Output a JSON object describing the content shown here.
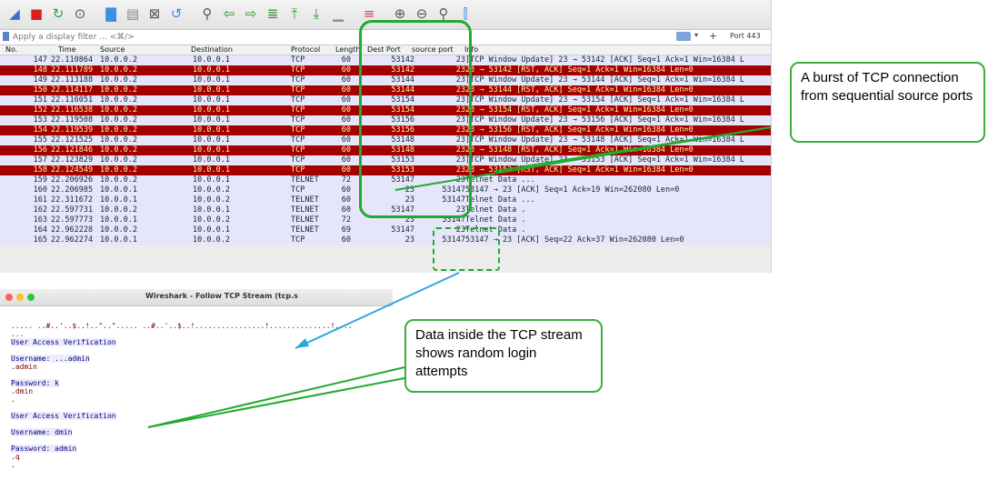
{
  "filter": {
    "placeholder": "Apply a display filter ... <⌘/>",
    "button_label": "Port 443"
  },
  "columns": [
    "No.",
    "Time",
    "Source",
    "Destination",
    "Protocol",
    "Length",
    "Dest Port",
    "source port",
    "Info"
  ],
  "packets": [
    {
      "no": "147",
      "time": "22.110864",
      "src": "10.0.0.2",
      "dst": "10.0.0.1",
      "proto": "TCP",
      "len": "60",
      "dport": "53142",
      "sport": "23",
      "info": "[TCP Window Update] 23 → 53142 [ACK] Seq=1 Ack=1 Win=16384 L",
      "kind": "win"
    },
    {
      "no": "148",
      "time": "22.111789",
      "src": "10.0.0.2",
      "dst": "10.0.0.1",
      "proto": "TCP",
      "len": "60",
      "dport": "53142",
      "sport": "23",
      "info": "23 → 53142 [RST, ACK] Seq=1 Ack=1 Win=16384 Len=0",
      "kind": "rst"
    },
    {
      "no": "149",
      "time": "22.113188",
      "src": "10.0.0.2",
      "dst": "10.0.0.1",
      "proto": "TCP",
      "len": "60",
      "dport": "53144",
      "sport": "23",
      "info": "[TCP Window Update] 23 → 53144 [ACK] Seq=1 Ack=1 Win=16384 L",
      "kind": "win"
    },
    {
      "no": "150",
      "time": "22.114117",
      "src": "10.0.0.2",
      "dst": "10.0.0.1",
      "proto": "TCP",
      "len": "60",
      "dport": "53144",
      "sport": "23",
      "info": "23 → 53144 [RST, ACK] Seq=1 Ack=1 Win=16384 Len=0",
      "kind": "rst"
    },
    {
      "no": "151",
      "time": "22.116051",
      "src": "10.0.0.2",
      "dst": "10.0.0.1",
      "proto": "TCP",
      "len": "60",
      "dport": "53154",
      "sport": "23",
      "info": "[TCP Window Update] 23 → 53154 [ACK] Seq=1 Ack=1 Win=16384 L",
      "kind": "win"
    },
    {
      "no": "152",
      "time": "22.116538",
      "src": "10.0.0.2",
      "dst": "10.0.0.1",
      "proto": "TCP",
      "len": "60",
      "dport": "53154",
      "sport": "23",
      "info": "23 → 53154 [RST, ACK] Seq=1 Ack=1 Win=16384 Len=0",
      "kind": "rst"
    },
    {
      "no": "153",
      "time": "22.119508",
      "src": "10.0.0.2",
      "dst": "10.0.0.1",
      "proto": "TCP",
      "len": "60",
      "dport": "53156",
      "sport": "23",
      "info": "[TCP Window Update] 23 → 53156 [ACK] Seq=1 Ack=1 Win=16384 L",
      "kind": "win"
    },
    {
      "no": "154",
      "time": "22.119539",
      "src": "10.0.0.2",
      "dst": "10.0.0.1",
      "proto": "TCP",
      "len": "60",
      "dport": "53156",
      "sport": "23",
      "info": "23 → 53156 [RST, ACK] Seq=1 Ack=1 Win=16384 Len=0",
      "kind": "rst"
    },
    {
      "no": "155",
      "time": "22.121525",
      "src": "10.0.0.2",
      "dst": "10.0.0.1",
      "proto": "TCP",
      "len": "60",
      "dport": "53148",
      "sport": "23",
      "info": "[TCP Window Update] 23 → 53148 [ACK] Seq=1 Ack=1 Win=16384 L",
      "kind": "win"
    },
    {
      "no": "156",
      "time": "22.121846",
      "src": "10.0.0.2",
      "dst": "10.0.0.1",
      "proto": "TCP",
      "len": "60",
      "dport": "53148",
      "sport": "23",
      "info": "23 → 53148 [RST, ACK] Seq=1 Ack=1 Win=16384 Len=0",
      "kind": "rst"
    },
    {
      "no": "157",
      "time": "22.123829",
      "src": "10.0.0.2",
      "dst": "10.0.0.1",
      "proto": "TCP",
      "len": "60",
      "dport": "53153",
      "sport": "23",
      "info": "[TCP Window Update] 23 → 53153 [ACK] Seq=1 Ack=1 Win=16384 L",
      "kind": "win"
    },
    {
      "no": "158",
      "time": "22.124549",
      "src": "10.0.0.2",
      "dst": "10.0.0.1",
      "proto": "TCP",
      "len": "60",
      "dport": "53153",
      "sport": "23",
      "info": "23 → 53153 [RST, ACK] Seq=1 Ack=1 Win=16384 Len=0",
      "kind": "rst"
    },
    {
      "no": "159",
      "time": "22.206926",
      "src": "10.0.0.2",
      "dst": "10.0.0.1",
      "proto": "TELNET",
      "len": "72",
      "dport": "53147",
      "sport": "23",
      "info": "Telnet Data ...",
      "kind": "tel"
    },
    {
      "no": "160",
      "time": "22.206985",
      "src": "10.0.0.1",
      "dst": "10.0.0.2",
      "proto": "TCP",
      "len": "60",
      "dport": "23",
      "sport": "53147",
      "info": "53147 → 23 [ACK] Seq=1 Ack=19 Win=262080 Len=0",
      "kind": "ack"
    },
    {
      "no": "161",
      "time": "22.311672",
      "src": "10.0.0.1",
      "dst": "10.0.0.2",
      "proto": "TELNET",
      "len": "60",
      "dport": "23",
      "sport": "53147",
      "info": "Telnet Data ...",
      "kind": "tel"
    },
    {
      "no": "162",
      "time": "22.597731",
      "src": "10.0.0.2",
      "dst": "10.0.0.1",
      "proto": "TELNET",
      "len": "60",
      "dport": "53147",
      "sport": "23",
      "info": "Telnet Data .",
      "kind": "tel"
    },
    {
      "no": "163",
      "time": "22.597773",
      "src": "10.0.0.1",
      "dst": "10.0.0.2",
      "proto": "TELNET",
      "len": "72",
      "dport": "23",
      "sport": "53147",
      "info": "Telnet Data .",
      "kind": "tel"
    },
    {
      "no": "164",
      "time": "22.962228",
      "src": "10.0.0.2",
      "dst": "10.0.0.1",
      "proto": "TELNET",
      "len": "69",
      "dport": "53147",
      "sport": "23",
      "info": "Telnet Data .",
      "kind": "tel"
    },
    {
      "no": "165",
      "time": "22.962274",
      "src": "10.0.0.1",
      "dst": "10.0.0.2",
      "proto": "TCP",
      "len": "60",
      "dport": "23",
      "sport": "53147",
      "info": "53147 → 23 [ACK] Seq=22 Ack=37 Win=262080 Len=0",
      "kind": "ack"
    }
  ],
  "stream_window": {
    "title": "Wireshark - Follow TCP Stream (tcp.s",
    "lines": [
      {
        "t": "..... ..#..'..$..!..\"..\"..... ..#..'..$..!................!..............!....",
        "c": "cl"
      },
      {
        "t": "...",
        "c": "cl"
      },
      {
        "t": "User Access Verification",
        "c": "sv"
      },
      {
        "t": "",
        "c": ""
      },
      {
        "t": "Username: ...admin",
        "c": "sv"
      },
      {
        "t": ".admin",
        "c": "cl"
      },
      {
        "t": "",
        "c": ""
      },
      {
        "t": "Password: k",
        "c": "sv"
      },
      {
        "t": ".dmin",
        "c": "cl"
      },
      {
        "t": ".",
        "c": "cl"
      },
      {
        "t": "",
        "c": ""
      },
      {
        "t": "User Access Verification",
        "c": "sv"
      },
      {
        "t": "",
        "c": ""
      },
      {
        "t": "Username: dmin",
        "c": "sv"
      },
      {
        "t": "",
        "c": ""
      },
      {
        "t": "Password: admin",
        "c": "sv"
      },
      {
        "t": ".q",
        "c": "cl"
      },
      {
        "t": ".",
        "c": "cl"
      }
    ]
  },
  "annotations": {
    "burst": "A burst of TCP connection from sequential source ports",
    "data": "Data inside the TCP stream shows random login attempts"
  },
  "colors": {
    "rst_bg": "#a40000",
    "rst_fg": "#fffc9c",
    "normal_bg": "#e6e6fb",
    "annot": "#22aa2f",
    "arrow": "#2aa8e0"
  }
}
